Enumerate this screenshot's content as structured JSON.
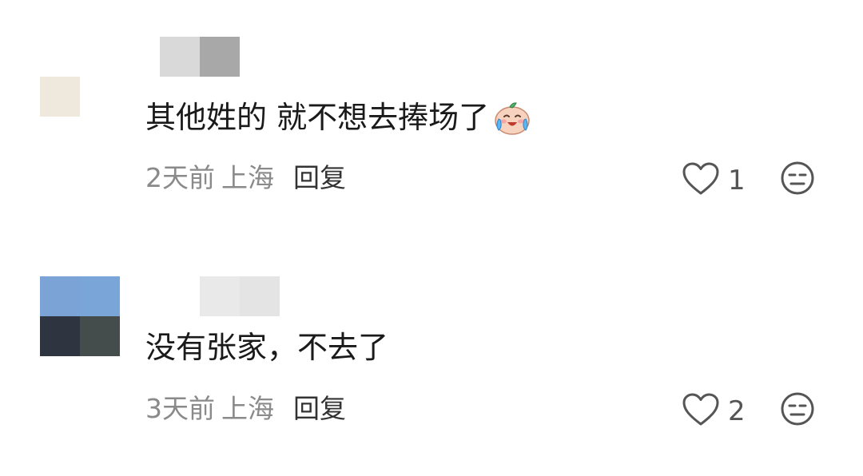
{
  "comments": [
    {
      "avatar_colors": [
        "#efe8dc"
      ],
      "username_blur_colors": [
        "#d9d9d9",
        "#a8a8a8"
      ],
      "text": "其他姓的 就不想去捧场了",
      "emoji": "crying-laughing-emoji",
      "time": "2天前",
      "location": "上海",
      "reply_label": "回复",
      "likes": "1"
    },
    {
      "avatar_colors": [
        "#7ba3d6",
        "#7aa5d8",
        "#2e3540",
        "#454d4c"
      ],
      "username_blur_colors": [
        "#e9e9e9",
        "#e4e4e4"
      ],
      "text": "没有张家，不去了",
      "time": "3天前",
      "location": "上海",
      "reply_label": "回复",
      "likes": "2"
    }
  ],
  "icons": {
    "like": "heart-outline-icon",
    "dislike": "unamused-face-icon"
  },
  "colors": {
    "text": "#1a1a1a",
    "meta": "#8a8a8a",
    "reply": "#333333",
    "icon": "#555555"
  }
}
